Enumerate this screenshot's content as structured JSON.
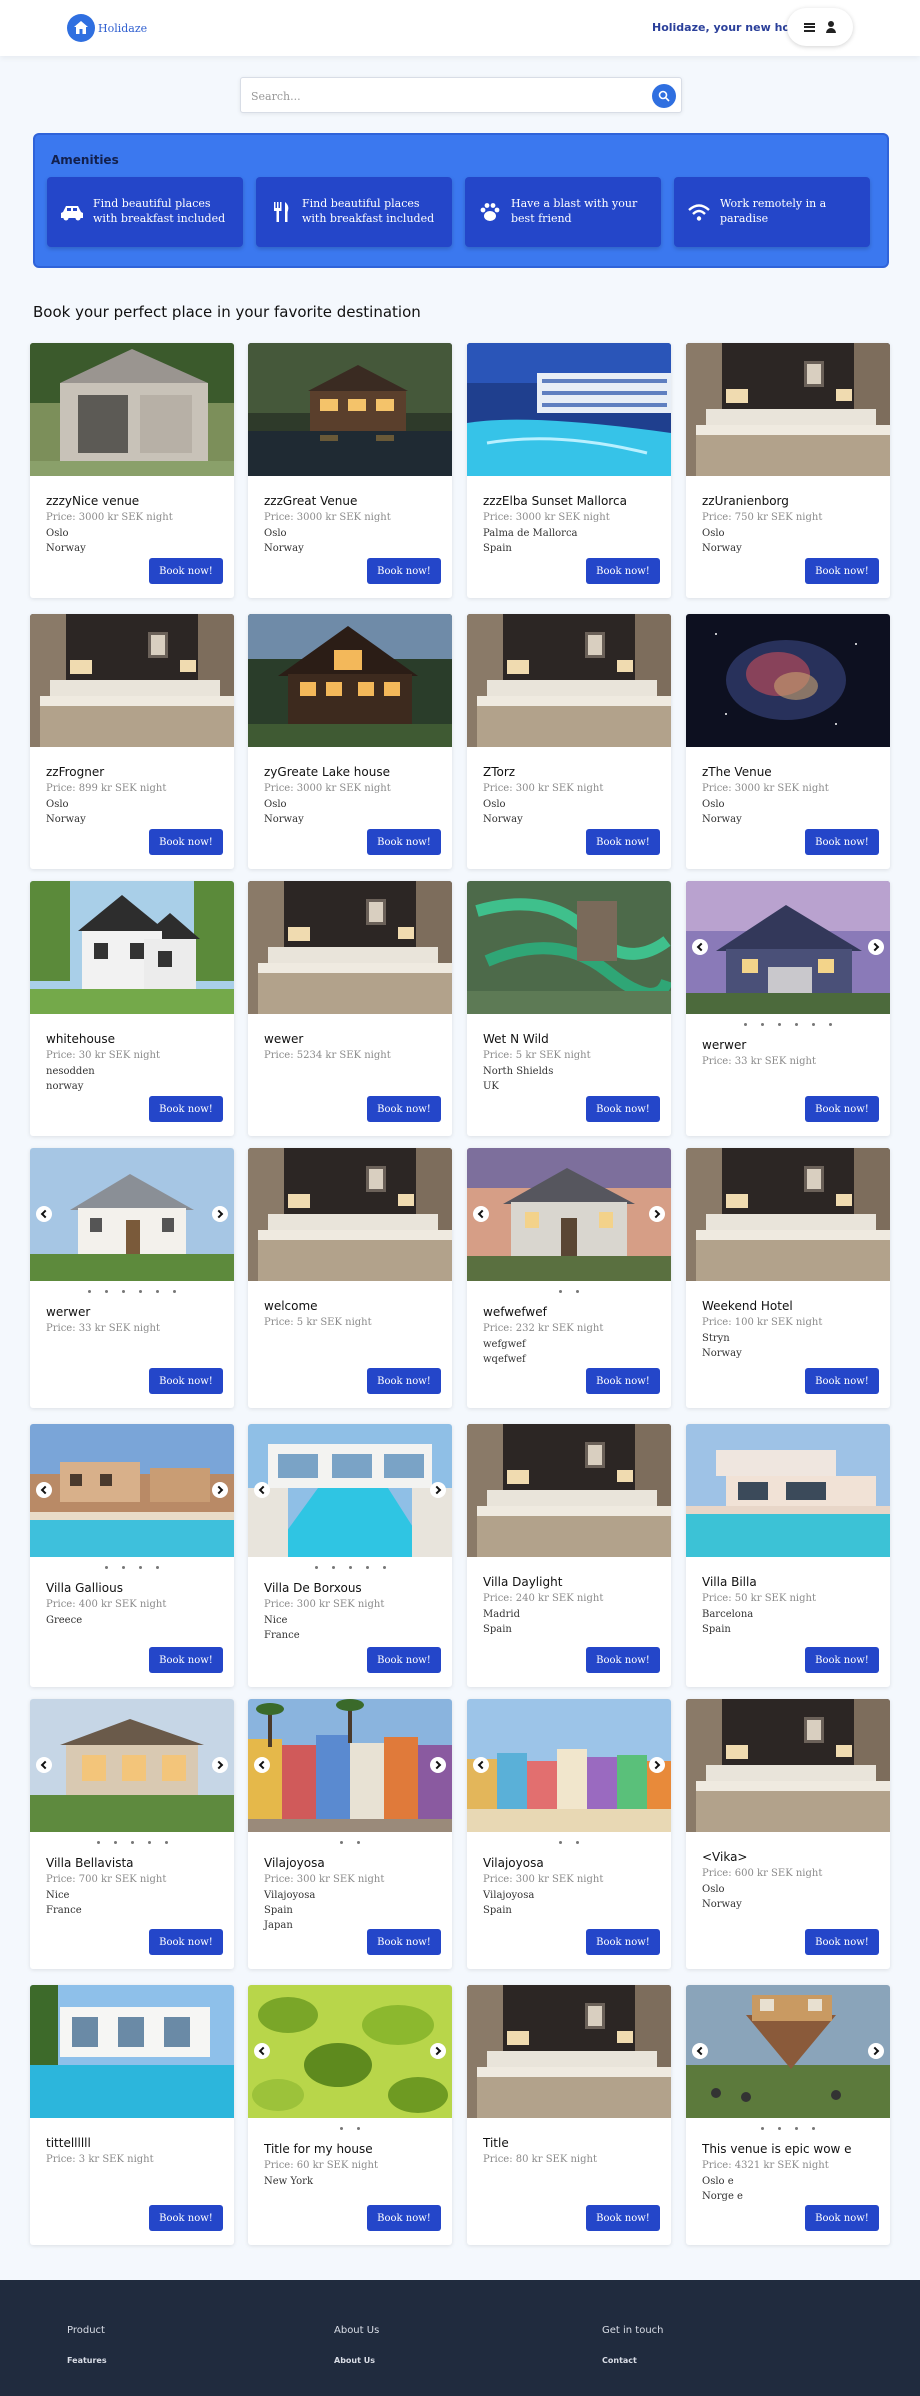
{
  "header": {
    "logo_text": "Holidaze",
    "tagline": "Holidaze, your new home"
  },
  "search": {
    "placeholder": "Search...",
    "value": ""
  },
  "amenities": {
    "title": "Amenities",
    "items": [
      {
        "icon": "car-icon",
        "text": "Find beautiful places with breakfast included"
      },
      {
        "icon": "cutlery-icon",
        "text": "Find beautiful places with breakfast included"
      },
      {
        "icon": "paw-icon",
        "text": "Have a blast with your best friend"
      },
      {
        "icon": "wifi-icon",
        "text": "Work remotely in a paradise"
      }
    ]
  },
  "section_title": "Book your perfect place in your favorite destination",
  "book_label": "Book now!",
  "venues": [
    {
      "name": "zzzyNice venue",
      "price": "Price: 3000 kr SEK night",
      "location": [
        "Oslo",
        "Norway"
      ],
      "image": "shed",
      "carousel": false
    },
    {
      "name": "zzzGreat Venue",
      "price": "Price: 3000 kr SEK night",
      "location": [
        "Oslo",
        "Norway"
      ],
      "image": "lakehouse-night",
      "carousel": false
    },
    {
      "name": "zzzElba Sunset Mallorca",
      "price": "Price: 3000 kr SEK night",
      "location": [
        "Palma de Mallorca",
        "Spain"
      ],
      "image": "resort-pool",
      "carousel": false
    },
    {
      "name": "zzUranienborg",
      "price": "Price: 750 kr SEK night",
      "location": [
        "Oslo",
        "Norway"
      ],
      "image": "hotel-room",
      "carousel": false
    },
    {
      "name": "zzFrogner",
      "price": "Price: 899 kr SEK night",
      "location": [
        "Oslo",
        "Norway"
      ],
      "image": "hotel-room",
      "carousel": false
    },
    {
      "name": "zyGreate Lake house",
      "price": "Price: 3000 kr SEK night",
      "location": [
        "Oslo",
        "Norway"
      ],
      "image": "lake-house",
      "carousel": false
    },
    {
      "name": "ZTorz",
      "price": "Price: 300 kr SEK night",
      "location": [
        "Oslo",
        "Norway"
      ],
      "image": "hotel-room",
      "carousel": false
    },
    {
      "name": "zThe Venue",
      "price": "Price: 3000 kr SEK night",
      "location": [
        "Oslo",
        "Norway"
      ],
      "image": "nebula",
      "carousel": false
    },
    {
      "name": "whitehouse",
      "price": "Price: 30 kr SEK night",
      "location": [
        "nesodden",
        "norway"
      ],
      "image": "white-house",
      "carousel": false
    },
    {
      "name": "wewer",
      "price": "Price: 5234 kr SEK night",
      "location": [],
      "image": "hotel-room",
      "carousel": false
    },
    {
      "name": "Wet N Wild",
      "price": "Price: 5 kr SEK night",
      "location": [
        "North Shields",
        "UK"
      ],
      "image": "waterpark",
      "carousel": false
    },
    {
      "name": "werwer",
      "price": "Price: 33 kr SEK night",
      "location": [],
      "image": "suburban-house",
      "carousel": true,
      "dot_count": 6
    },
    {
      "name": "werwer",
      "price": "Price: 33 kr SEK night",
      "location": [],
      "image": "cottage",
      "carousel": true,
      "dot_count": 6
    },
    {
      "name": "welcome",
      "price": "Price: 5 kr SEK night",
      "location": [],
      "image": "hotel-room",
      "carousel": false
    },
    {
      "name": "wefwefwef",
      "price": "Price: 232 kr SEK night",
      "location": [
        "wefgwef",
        "wqefwef"
      ],
      "image": "manor",
      "carousel": true,
      "dot_count": 2
    },
    {
      "name": "Weekend Hotel",
      "price": "Price: 100 kr SEK night",
      "location": [
        "Stryn",
        "Norway"
      ],
      "image": "hotel-room",
      "carousel": false
    },
    {
      "name": "Villa Gallious",
      "price": "Price: 400 kr SEK night",
      "location": [
        "Greece"
      ],
      "image": "villa-greece",
      "carousel": true,
      "dot_count": 4
    },
    {
      "name": "Villa De Borxous",
      "price": "Price: 300 kr SEK night",
      "location": [
        "Nice",
        "France"
      ],
      "image": "villa-pool",
      "carousel": true,
      "dot_count": 5
    },
    {
      "name": "Villa Daylight",
      "price": "Price: 240 kr SEK night",
      "location": [
        "Madrid",
        "Spain"
      ],
      "image": "hotel-room",
      "carousel": false
    },
    {
      "name": "Villa Billa",
      "price": "Price: 50 kr SEK night",
      "location": [
        "Barcelona",
        "Spain"
      ],
      "image": "modern-villa",
      "carousel": false
    },
    {
      "name": "Villa Bellavista",
      "price": "Price: 700 kr SEK night",
      "location": [
        "Nice",
        "France"
      ],
      "image": "bellavista",
      "carousel": true,
      "dot_count": 5
    },
    {
      "name": "Vilajoyosa",
      "price": "Price: 300 kr SEK night",
      "location": [
        "Vilajoyosa",
        "Spain",
        "Japan"
      ],
      "image": "colorful-houses",
      "carousel": true,
      "dot_count": 2
    },
    {
      "name": "Vilajoyosa",
      "price": "Price: 300 kr SEK night",
      "location": [
        "Vilajoyosa",
        "Spain"
      ],
      "image": "colorful-town",
      "carousel": true,
      "dot_count": 2
    },
    {
      "name": "<Vika>",
      "price": "Price: 600 kr SEK night",
      "location": [
        "Oslo",
        "Norway"
      ],
      "image": "hotel-room",
      "carousel": false
    },
    {
      "name": "tittellllll",
      "price": "Price: 3 kr SEK night",
      "location": [],
      "image": "white-villa",
      "carousel": false
    },
    {
      "name": "Title for my house",
      "price": "Price: 60 kr SEK night",
      "location": [
        "New York"
      ],
      "image": "green-leaves",
      "carousel": true,
      "dot_count": 2
    },
    {
      "name": "Title",
      "price": "Price: 80 kr SEK night",
      "location": [],
      "image": "hotel-room",
      "carousel": false
    },
    {
      "name": "This venue is epic wow e",
      "price": "Price: 4321 kr SEK night",
      "location": [
        "Oslo e",
        "Norge e"
      ],
      "image": "upside-down-house",
      "carousel": true,
      "dot_count": 4
    }
  ],
  "footer": {
    "columns": [
      {
        "heading": "Product",
        "link": "Features"
      },
      {
        "heading": "About Us",
        "link": "About Us"
      },
      {
        "heading": "Get in touch",
        "link": "Contact"
      }
    ]
  },
  "colors": {
    "brand_blue": "#2f6fe0",
    "button_blue": "#2446c9",
    "amenities_bg": "#3b78ef",
    "footer_bg": "#202b3e"
  }
}
